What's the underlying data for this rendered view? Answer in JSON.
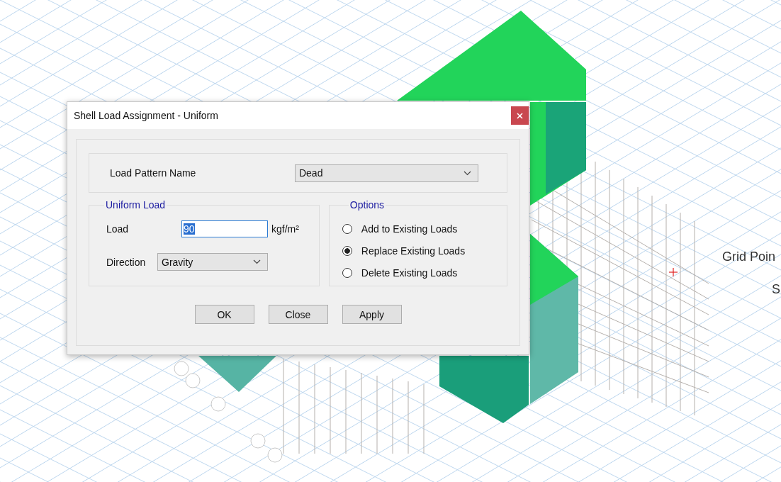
{
  "window": {
    "title": "Shell Load Assignment - Uniform"
  },
  "load_pattern": {
    "label": "Load Pattern Name",
    "value": "Dead"
  },
  "uniform_load": {
    "title": "Uniform Load",
    "load_label": "Load",
    "load_value": "90",
    "load_text_selected": true,
    "unit": "kgf/m²",
    "direction_label": "Direction",
    "direction_value": "Gravity"
  },
  "options": {
    "title": "Options",
    "items": [
      {
        "label": "Add to Existing Loads",
        "selected": false
      },
      {
        "label": "Replace Existing Loads",
        "selected": true
      },
      {
        "label": "Delete Existing Loads",
        "selected": false
      }
    ]
  },
  "buttons": [
    "OK",
    "Close",
    "Apply"
  ],
  "canvas": {
    "labels": [
      "Grid Poin",
      "S"
    ]
  }
}
